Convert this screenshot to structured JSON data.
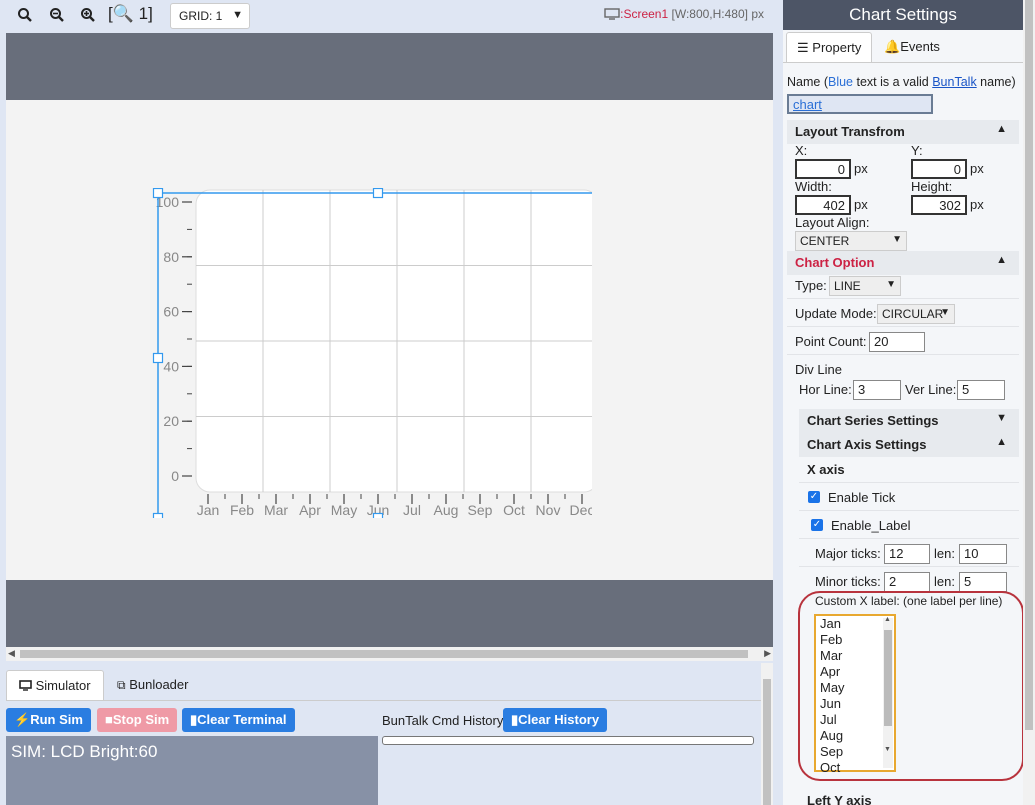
{
  "toolbar": {
    "zoom_label": "[🔍 1]",
    "grid_label": "GRID: 1",
    "screen_name": ":Screen1",
    "screen_size": "[W:800,H:480] px"
  },
  "chart_data": {
    "type": "line",
    "categories": [
      "Jan",
      "Feb",
      "Mar",
      "Apr",
      "May",
      "Jun",
      "Jul",
      "Aug",
      "Sep",
      "Oct",
      "Nov",
      "Dec"
    ],
    "series": [],
    "yticks": [
      0,
      20,
      40,
      60,
      80,
      100
    ],
    "ylim": [
      0,
      100
    ],
    "hor_lines": 3,
    "ver_lines": 5,
    "grid": true
  },
  "bottom": {
    "tab_simulator": "Simulator",
    "tab_bunloader": "Bunloader",
    "run_sim": "Run Sim",
    "stop_sim": "Stop Sim",
    "clear_terminal": "Clear Terminal",
    "history_label": "BunTalk Cmd History",
    "clear_history": "Clear History",
    "terminal_text": "SIM: LCD Bright:60"
  },
  "panel": {
    "title": "Chart Settings",
    "tab_property": "Property",
    "tab_events": "Events",
    "name_prefix": "Name (",
    "name_blue": "Blue",
    "name_mid": " text is a valid ",
    "name_link": "BunTalk",
    "name_suffix": " name)",
    "name_value": "chart",
    "layout_section": "Layout Transfrom",
    "x_label": "X:",
    "y_label": "Y:",
    "x_value": "0",
    "y_value": "0",
    "px": "px",
    "width_label": "Width:",
    "height_label": "Height:",
    "width_value": "402",
    "height_value": "302",
    "align_label": "Layout Align:",
    "align_value": "CENTER",
    "chart_option": "Chart Option",
    "type_label": "Type:",
    "type_value": "LINE",
    "update_label": "Update Mode:",
    "update_value": "CIRCULAR",
    "point_label": "Point Count:",
    "point_value": "20",
    "divline_label": "Div Line",
    "hor_label": "Hor Line:",
    "hor_value": "3",
    "ver_label": "Ver Line:",
    "ver_value": "5",
    "series_section": "Chart Series Settings",
    "axis_section": "Chart Axis Settings",
    "xaxis_label": "X axis",
    "enable_tick": "Enable Tick",
    "enable_label": "Enable_Label",
    "major_label": "Major ticks:",
    "major_value": "12",
    "major_len_label": "len:",
    "major_len_value": "10",
    "minor_label": "Minor ticks:",
    "minor_value": "2",
    "minor_len_label": "len:",
    "minor_len_value": "5",
    "custom_label": "Custom X label: (one label per line)",
    "custom_items": [
      "Jan",
      "Feb",
      "Mar",
      "Apr",
      "May",
      "Jun",
      "Jul",
      "Aug",
      "Sep",
      "Oct"
    ],
    "left_y": "Left Y axis"
  },
  "colors": {
    "accent": "#2a7de1",
    "panel_header": "#4d5566",
    "chart_option": "#cc2244",
    "selection": "#3399ee"
  }
}
